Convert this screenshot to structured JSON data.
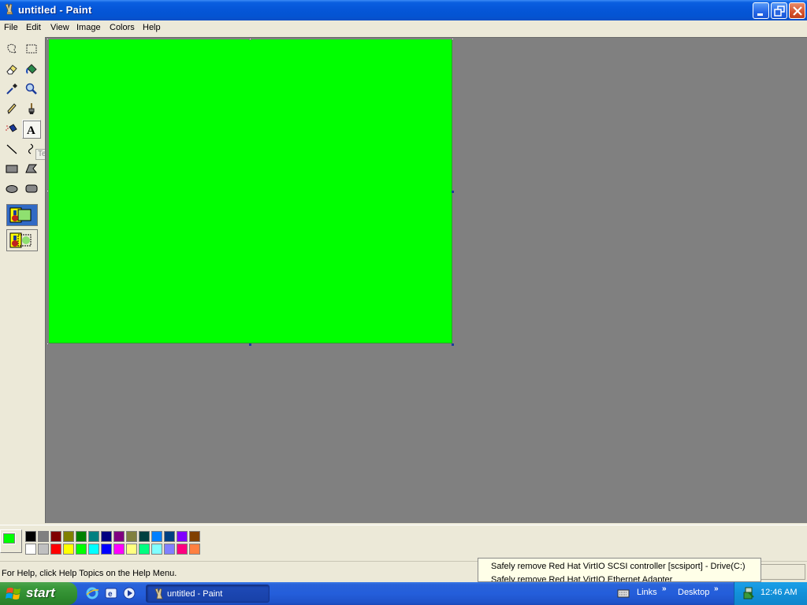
{
  "window": {
    "title": "untitled - Paint",
    "controls": [
      "minimize",
      "restore",
      "close"
    ]
  },
  "menubar": {
    "items": [
      "File",
      "Edit",
      "View",
      "Image",
      "Colors",
      "Help"
    ]
  },
  "toolbox": {
    "tools": [
      {
        "name": "free-form-select",
        "icon": "freeform-select-icon"
      },
      {
        "name": "select",
        "icon": "rect-select-icon"
      },
      {
        "name": "eraser",
        "icon": "eraser-icon"
      },
      {
        "name": "fill",
        "icon": "fill-bucket-icon"
      },
      {
        "name": "pick-color",
        "icon": "eyedropper-icon"
      },
      {
        "name": "magnifier",
        "icon": "magnifier-icon"
      },
      {
        "name": "pencil",
        "icon": "pencil-icon"
      },
      {
        "name": "brush",
        "icon": "brush-icon"
      },
      {
        "name": "airbrush",
        "icon": "airbrush-icon"
      },
      {
        "name": "text",
        "icon": "text-icon",
        "selected": true
      },
      {
        "name": "line",
        "icon": "line-icon"
      },
      {
        "name": "curve",
        "icon": "curve-icon"
      },
      {
        "name": "rectangle",
        "icon": "rectangle-icon"
      },
      {
        "name": "polygon",
        "icon": "polygon-icon"
      },
      {
        "name": "ellipse",
        "icon": "ellipse-icon"
      },
      {
        "name": "rounded-rectangle",
        "icon": "rounded-rect-icon"
      }
    ],
    "tooltip": "Text"
  },
  "canvas": {
    "fill_color": "#00ff00",
    "workspace_color": "#808080"
  },
  "colors": {
    "foreground": "#00ff00",
    "background": "#ffffff",
    "palette_row1": [
      "#000000",
      "#808080",
      "#800000",
      "#808000",
      "#008000",
      "#008080",
      "#000080",
      "#800080",
      "#808040",
      "#004040",
      "#0080ff",
      "#004080",
      "#8000ff",
      "#804000"
    ],
    "palette_row2": [
      "#ffffff",
      "#c0c0c0",
      "#ff0000",
      "#ffff00",
      "#00ff00",
      "#00ffff",
      "#0000ff",
      "#ff00ff",
      "#ffff80",
      "#00ff80",
      "#80ffff",
      "#8080ff",
      "#ff0080",
      "#ff8040"
    ]
  },
  "statusbar": {
    "help_text": "For Help, click Help Topics on the Help Menu."
  },
  "balloon": {
    "line1": "Safely remove Red Hat VirtIO SCSI controller [scsiport] - Drive(C:)",
    "line2": "Safely remove Red Hat VirtIO Ethernet Adapter"
  },
  "taskbar": {
    "start_label": "start",
    "task_button": "untitled - Paint",
    "links_label": "Links",
    "desktop_label": "Desktop",
    "clock": "12:46 AM"
  }
}
